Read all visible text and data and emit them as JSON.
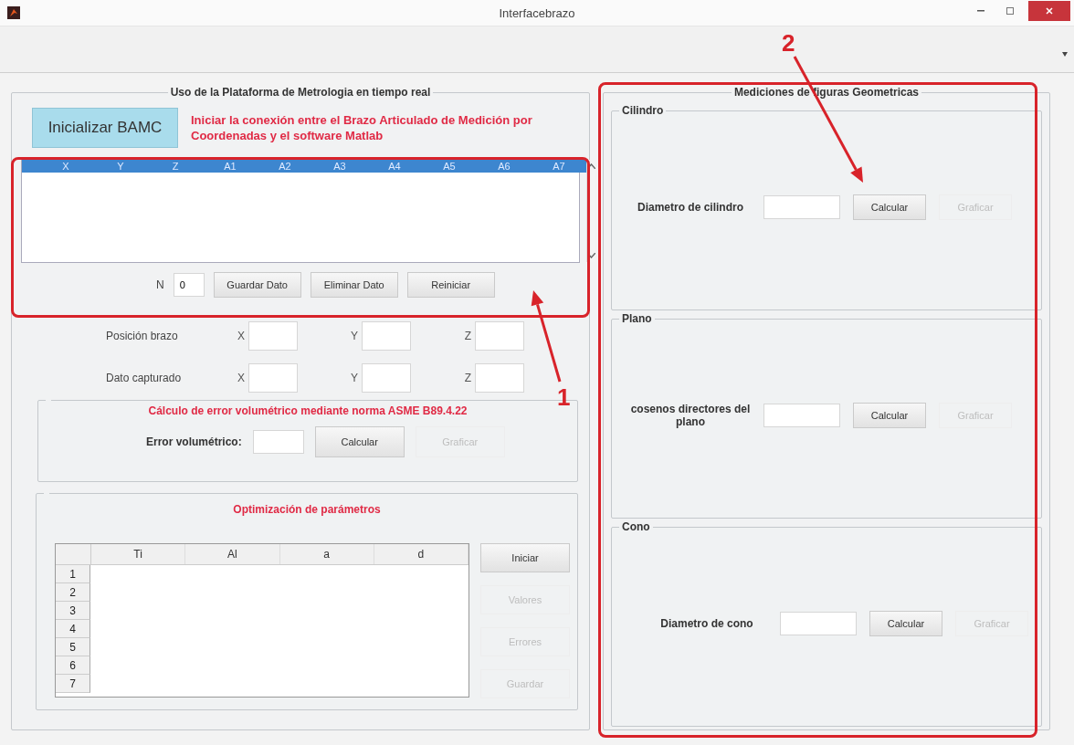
{
  "window": {
    "title": "Interfacebrazo"
  },
  "platform": {
    "title": "Uso de la Plataforma de Metrologia en tiempo real",
    "init_button": "Inicializar BAMC",
    "init_note": "Iniciar la conexión entre el Brazo Articulado de Medición por Coordenadas y el software Matlab",
    "data_table": {
      "columns": [
        "X",
        "Y",
        "Z",
        "A1",
        "A2",
        "A3",
        "A4",
        "A5",
        "A6",
        "A7"
      ]
    },
    "n_label": "N",
    "n_value": "0",
    "buttons": [
      {
        "label": "Guardar Dato",
        "disabled": false
      },
      {
        "label": "Eliminar Dato",
        "disabled": false
      },
      {
        "label": "Reiniciar",
        "disabled": false
      }
    ],
    "positions": [
      {
        "label": "Posición brazo",
        "axes": [
          "X",
          "Y",
          "Z"
        ]
      },
      {
        "label": "Dato capturado",
        "axes": [
          "X",
          "Y",
          "Z"
        ]
      }
    ]
  },
  "error": {
    "title": "Cálculo de error volumétrico mediante norma ASME B89.4.22",
    "label": "Error volumétrico:",
    "buttons": [
      {
        "label": "Calcular",
        "disabled": false
      },
      {
        "label": "Graficar",
        "disabled": true
      }
    ]
  },
  "optimization": {
    "title": "Optimización de parámetros",
    "table": {
      "columns": [
        "Ti",
        "Al",
        "a",
        "d"
      ],
      "row_numbers": [
        "1",
        "2",
        "3",
        "4",
        "5",
        "6",
        "7"
      ]
    },
    "buttons": [
      {
        "label": "Iniciar",
        "disabled": false
      },
      {
        "label": "Valores",
        "disabled": true
      },
      {
        "label": "Errores",
        "disabled": true
      },
      {
        "label": "Guardar",
        "disabled": true
      }
    ]
  },
  "measurements": {
    "title": "Mediciones de figuras Geometricas",
    "sections": [
      {
        "title": "Cilindro",
        "label": "Diametro de cilindro",
        "buttons": [
          {
            "label": "Calcular",
            "disabled": false
          },
          {
            "label": "Graficar",
            "disabled": true
          }
        ]
      },
      {
        "title": "Plano",
        "label": "cosenos directores del plano",
        "buttons": [
          {
            "label": "Calcular",
            "disabled": false
          },
          {
            "label": "Graficar",
            "disabled": true
          }
        ]
      },
      {
        "title": "Cono",
        "label": "Diametro de cono",
        "buttons": [
          {
            "label": "Calcular",
            "disabled": false
          },
          {
            "label": "Graficar",
            "disabled": true
          }
        ]
      }
    ]
  },
  "annotations": [
    {
      "label": "1"
    },
    {
      "label": "2"
    }
  ]
}
